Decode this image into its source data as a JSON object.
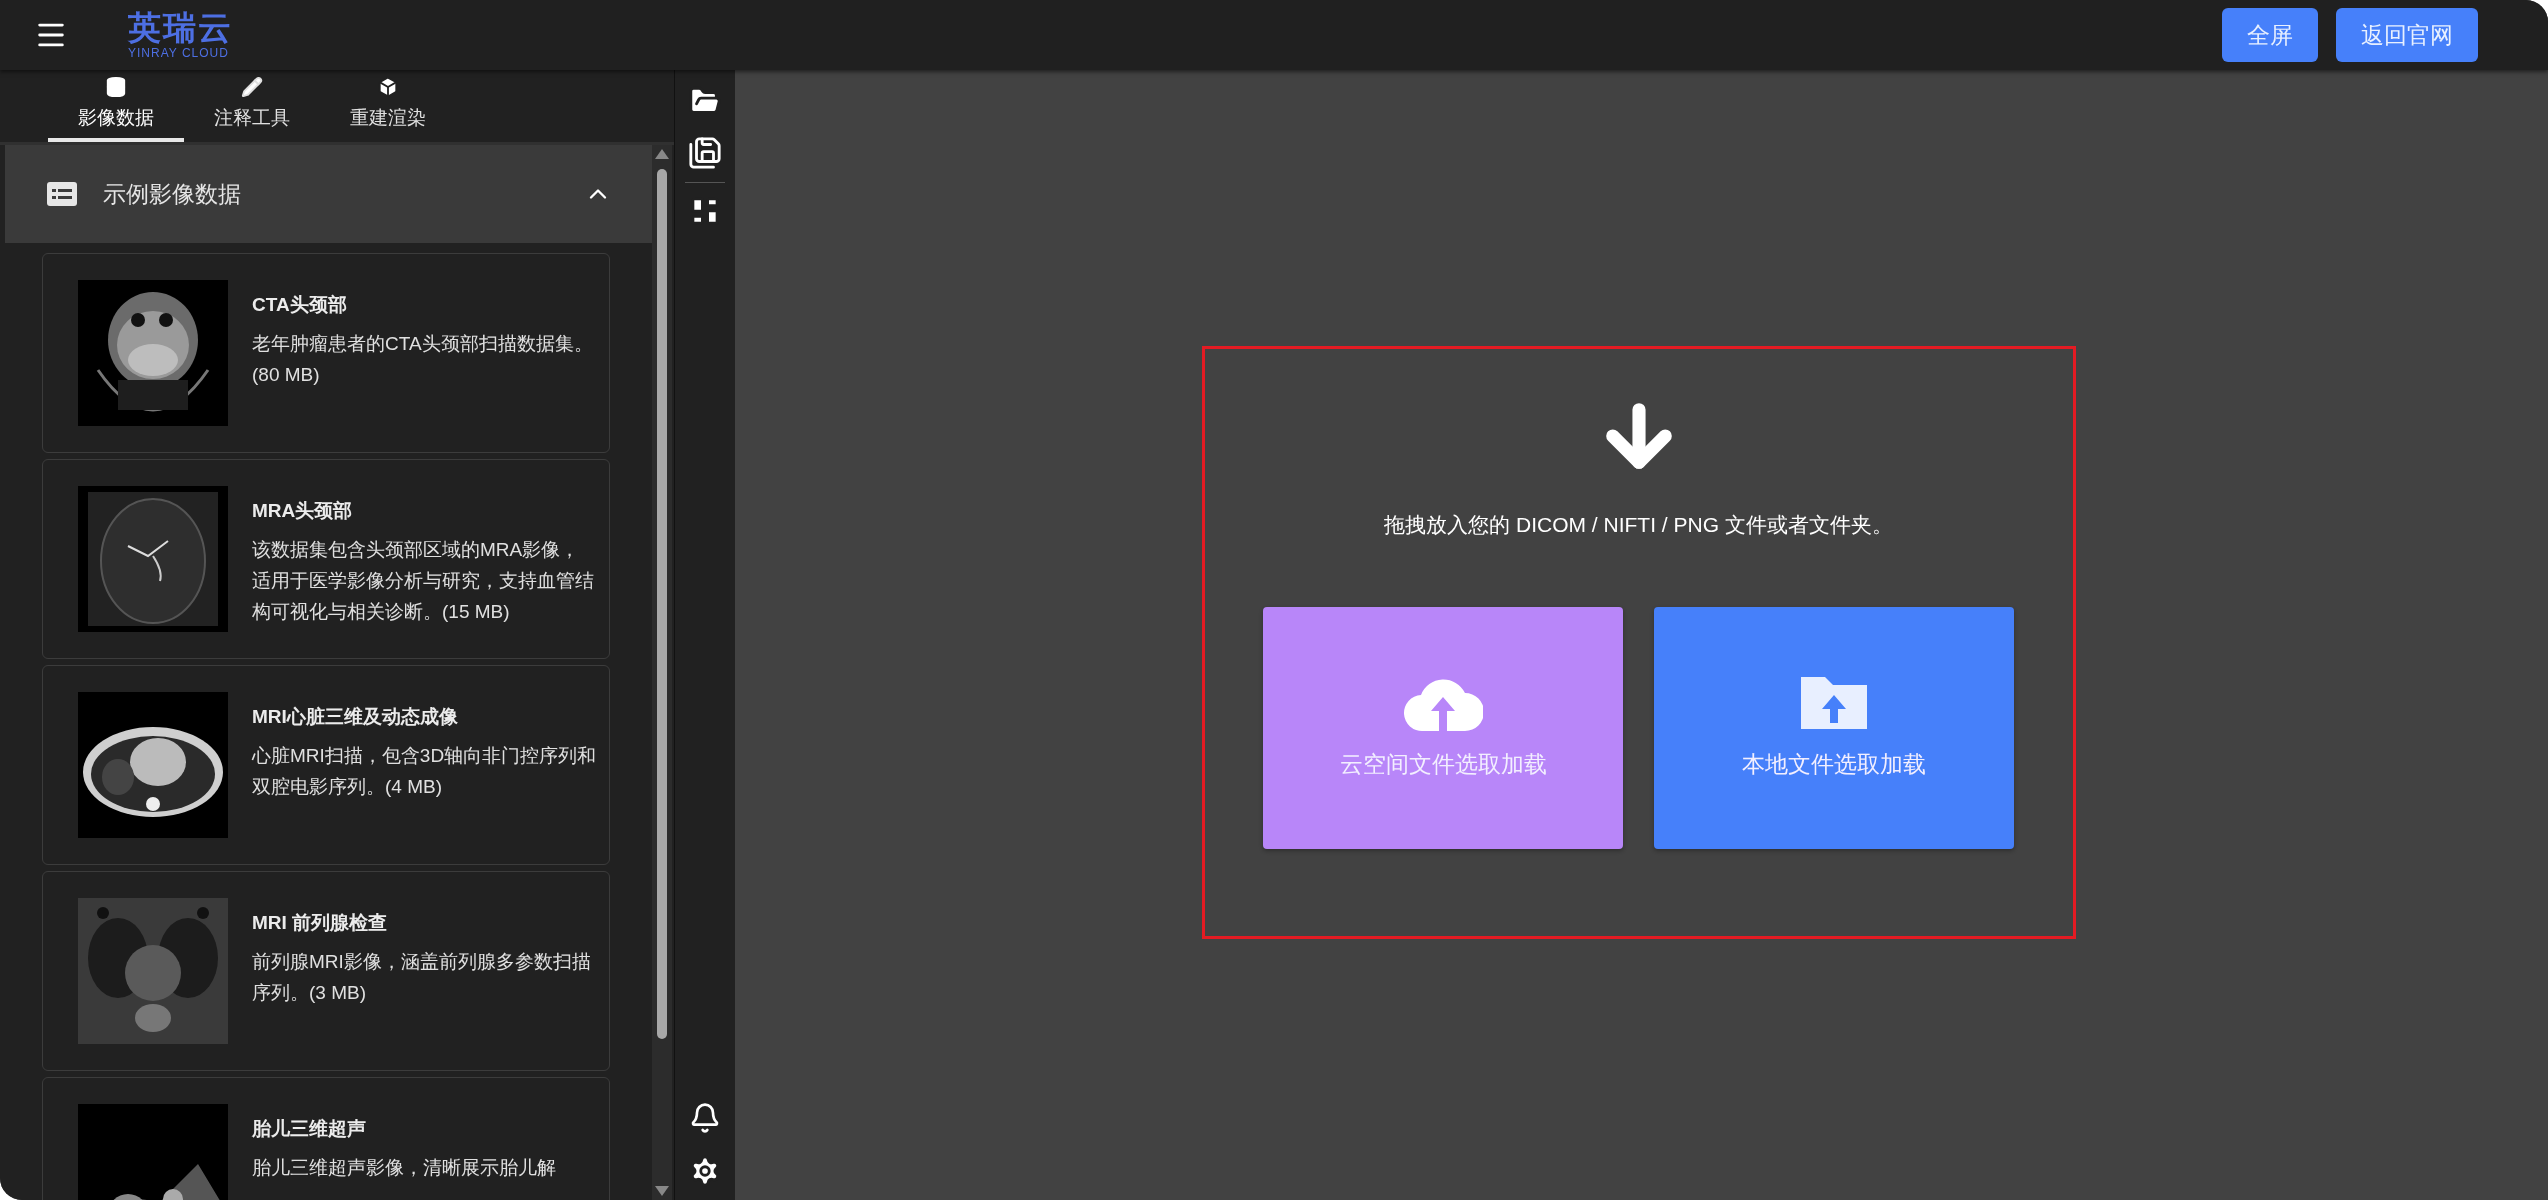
{
  "header": {
    "logo": {
      "name": "英瑞云",
      "subtitle": "YINRAY CLOUD"
    },
    "buttons": [
      "全屏",
      "返回官网"
    ]
  },
  "sidebar": {
    "tabs": [
      {
        "label": "影像数据",
        "kind": "database",
        "selected": true
      },
      {
        "label": "注释工具",
        "kind": "pencil",
        "selected": false
      },
      {
        "label": "重建渲染",
        "kind": "cube",
        "selected": false
      }
    ],
    "section": {
      "title": "示例影像数据",
      "expanded": true
    },
    "datasets": [
      {
        "title": "CTA头颈部",
        "description": "老年肿瘤患者的CTA头颈部扫描数据集。(80 MB)"
      },
      {
        "title": "MRA头颈部",
        "description": "该数据集包含头颈部区域的MRA影像，适用于医学影像分析与研究，支持血管结构可视化与相关诊断。(15 MB)"
      },
      {
        "title": "MRI心脏三维及动态成像",
        "description": "心脏MRI扫描，包含3D轴向非门控序列和双腔电影序列。(4 MB)"
      },
      {
        "title": "MRI 前列腺检查",
        "description": "前列腺MRI影像，涵盖前列腺多参数扫描序列。(3 MB)"
      },
      {
        "title": "胎儿三维超声",
        "description": "胎儿三维超声影像，清晰展示胎儿解"
      }
    ]
  },
  "drop_zone": {
    "message": "拖拽放入您的 DICOM / NIFTI / PNG 文件或者文件夹。",
    "actions": [
      {
        "label": "云空间文件选取加载",
        "kind": "cloud",
        "color": "#b886f9"
      },
      {
        "label": "本地文件选取加载",
        "kind": "local",
        "color": "#4680fa"
      }
    ]
  }
}
